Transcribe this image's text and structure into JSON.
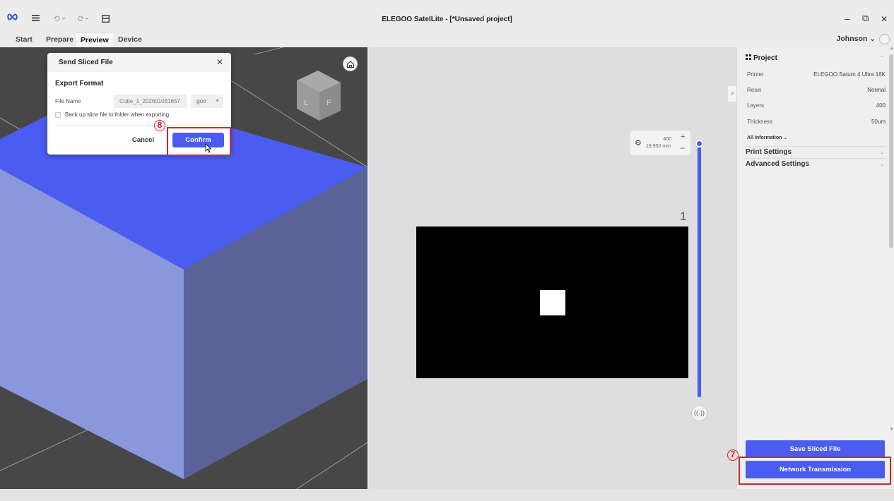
{
  "window": {
    "title": "ELEGOO SatelLite - [*Unsaved project]",
    "logo": "infinity-logo",
    "controls": [
      "minimize",
      "restore",
      "close"
    ],
    "minimize_glyph": "–",
    "restore_glyph": "⧉",
    "close_glyph": "✕"
  },
  "nav": {
    "tabs": [
      {
        "label": "Start"
      },
      {
        "label": "Prepare"
      },
      {
        "label": "Preview"
      },
      {
        "label": "Device"
      }
    ],
    "active_tab": "Preview",
    "user": "Johnson ⌄"
  },
  "dialog": {
    "title": "Send Sliced File",
    "close_glyph": "✕",
    "section_title": "Export Format",
    "file_name_label": "File Name",
    "file_name_value": "Cube_1_202601081657",
    "extension": ".goo",
    "extension_caret": "▼",
    "backup_label": "Back up slice file to folder when exporting",
    "backup_checked": false,
    "cancel_label": "Cancel",
    "confirm_label": "Confirm"
  },
  "annotations": {
    "step_confirm": "8",
    "step_network": "7",
    "highlight_color": "#e0202a"
  },
  "layer_view": {
    "layer_count": "400",
    "height": "19.950 mm",
    "current_layer": "1",
    "plus": "+",
    "minus": "−",
    "expand_glyph": ">",
    "gear_glyph": "⚙",
    "play_glyph": "((·))"
  },
  "project": {
    "title": "Project",
    "collapse_glyph": "⌃",
    "properties": [
      {
        "key": "Printer",
        "value": "ELEGOO Saturn 4 Ultra 16K"
      },
      {
        "key": "Resin",
        "value": "Normal"
      },
      {
        "key": "Layers",
        "value": "400"
      },
      {
        "key": "Thickness",
        "value": "50um"
      }
    ],
    "all_information": "All Information ⌄",
    "sections": [
      {
        "label": "Print Settings"
      },
      {
        "label": "Advanced Settings"
      }
    ],
    "section_glyph": "⌄"
  },
  "actions": {
    "save_sliced_file": "Save Sliced File",
    "network_transmission": "Network Transmission"
  },
  "colors": {
    "accent": "#4b5cf0",
    "cube_top": "#4b5cf0",
    "cube_left": "#8a97dd",
    "cube_right": "#5a6398",
    "viewport_bg": "#474747"
  }
}
